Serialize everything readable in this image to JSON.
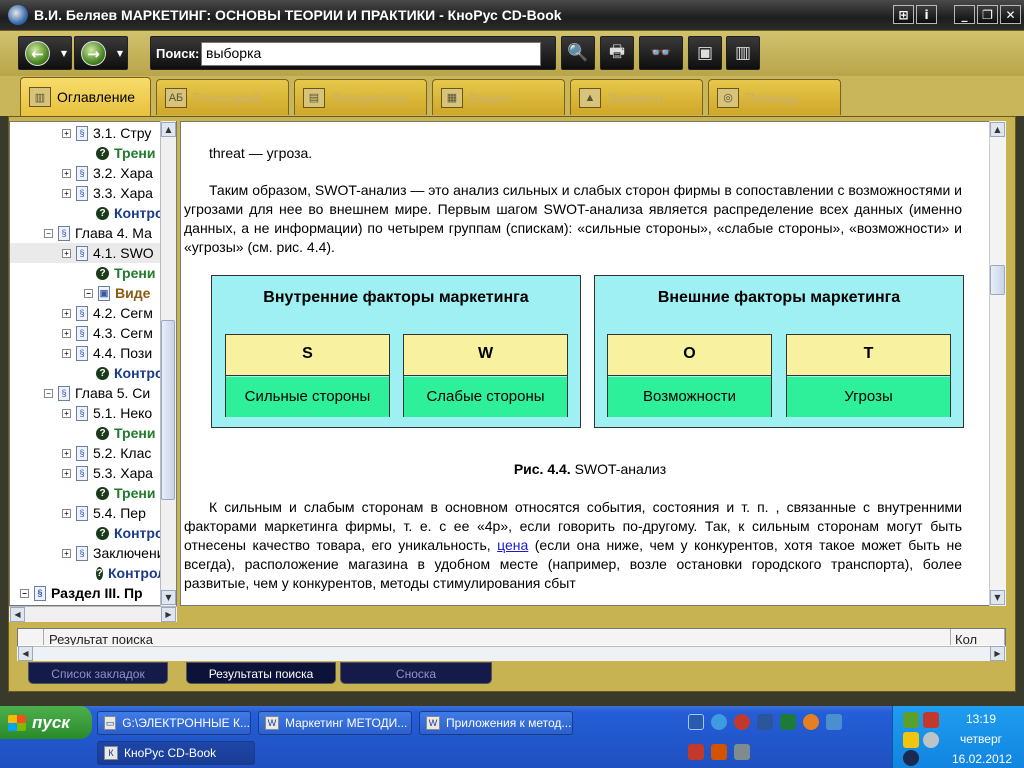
{
  "window": {
    "title": "В.И. Беляев МАРКЕТИНГ: ОСНОВЫ ТЕОРИИ И ПРАКТИКИ - КноРус CD-Book",
    "buttons": [
      "⊞",
      "i",
      "_",
      "❐",
      "✕"
    ]
  },
  "toolbar": {
    "back_icon": "←",
    "forward_icon": "→",
    "search_label": "Поиск:",
    "search_value": "выборка"
  },
  "tabs": [
    {
      "label": "Оглавление",
      "icon": "book-icon"
    },
    {
      "label": "Глоссарий",
      "icon": "abc-icon"
    },
    {
      "label": "Литература",
      "icon": "books-icon"
    },
    {
      "label": "Видео",
      "icon": "film-icon"
    },
    {
      "label": "Экзамен",
      "icon": "graduation-cap-icon"
    },
    {
      "label": "Помощь",
      "icon": "lifebuoy-icon"
    }
  ],
  "tree": [
    {
      "label": "3.1. Стру",
      "kind": "doc",
      "style": "plain"
    },
    {
      "label": "Трени",
      "kind": "q",
      "style": "green"
    },
    {
      "label": "3.2. Хара",
      "kind": "doc",
      "style": "plain"
    },
    {
      "label": "3.3. Хара",
      "kind": "doc",
      "style": "plain"
    },
    {
      "label": "Контрол",
      "kind": "q",
      "style": "navy"
    },
    {
      "label": "Глава 4. Ма",
      "kind": "chapter",
      "style": "plain"
    },
    {
      "label": "4.1. SWO",
      "kind": "doc",
      "style": "sel"
    },
    {
      "label": "Трени",
      "kind": "q",
      "style": "green"
    },
    {
      "label": "Виде",
      "kind": "video",
      "style": "brown"
    },
    {
      "label": "4.2. Сегм",
      "kind": "doc",
      "style": "plain"
    },
    {
      "label": "4.3. Сегм",
      "kind": "doc",
      "style": "plain"
    },
    {
      "label": "4.4. Пози",
      "kind": "doc",
      "style": "plain"
    },
    {
      "label": "Контрол",
      "kind": "q",
      "style": "navy"
    },
    {
      "label": "Глава 5. Си",
      "kind": "chapter",
      "style": "plain"
    },
    {
      "label": "5.1. Неко",
      "kind": "doc",
      "style": "plain"
    },
    {
      "label": "Трени",
      "kind": "q",
      "style": "green"
    },
    {
      "label": "5.2. Клас",
      "kind": "doc",
      "style": "plain"
    },
    {
      "label": "5.3. Хара",
      "kind": "doc",
      "style": "plain"
    },
    {
      "label": "Трени",
      "kind": "q",
      "style": "green"
    },
    {
      "label": "5.4. Пер",
      "kind": "doc",
      "style": "plain"
    },
    {
      "label": "Контрол",
      "kind": "q",
      "style": "navy"
    },
    {
      "label": "Заключени",
      "kind": "doc",
      "style": "plain"
    },
    {
      "label": "Контролы",
      "kind": "q",
      "style": "navy"
    },
    {
      "label": "Раздел III. Пр",
      "kind": "chapter",
      "style": "bold"
    }
  ],
  "content": {
    "line_threat": "threat — угроза.",
    "para1": "Таким образом, SWOT-анализ — это анализ сильных и слабых сторон фирмы в сопоставлении с возможностями и угрозами для нее во внешнем мире. Первым шагом SWOT-анализа является распределение всех данных (именно данных, а не информации) по четырем группам (спискам): «сильные стороны», «слабые стороны», «возможности» и «угрозы» (см. рис. 4.4).",
    "internal_header": "Внутренние факторы маркетинга",
    "external_header": "Внешние факторы маркетинга",
    "quadrants": [
      {
        "letter": "S",
        "name": "Сильные стороны"
      },
      {
        "letter": "W",
        "name": "Слабые стороны"
      },
      {
        "letter": "O",
        "name": "Возможности"
      },
      {
        "letter": "T",
        "name": "Угрозы"
      }
    ],
    "caption_bold": "Рис. 4.4.",
    "caption_text": " SWOT-анализ",
    "para2_before": "К сильным и слабым сторонам в основном относятся события, состояния и т. п. , связанные с внутренними факторами маркетинга фирмы, т. е. с ее «4р», если говорить по-другому. Так, к сильным сторонам могут быть отнесены качество товара, его уникальность, ",
    "para2_link": "цена",
    "para2_after": " (если она ниже, чем у конкурентов, хотя такое может быть не всегда), расположение магазина в удобном месте (например, возле остановки городского транспорта), более развитые, чем у конкурентов, методы стимулирования сбыт"
  },
  "results": {
    "col_result": "Результат поиска",
    "col_count": "Кол"
  },
  "bottom_tabs": [
    "Список закладок",
    "Результаты поиска",
    "Сноска"
  ],
  "taskbar": {
    "start_label": "пуск",
    "tasks": [
      "G:\\ЭЛЕКТРОННЫЕ К...",
      "Маркетинг МЕТОДИ...",
      "Приложения к метод...",
      "КноРус CD-Book"
    ],
    "time": "13:19",
    "day": "четверг",
    "date": "16.02.2012"
  }
}
